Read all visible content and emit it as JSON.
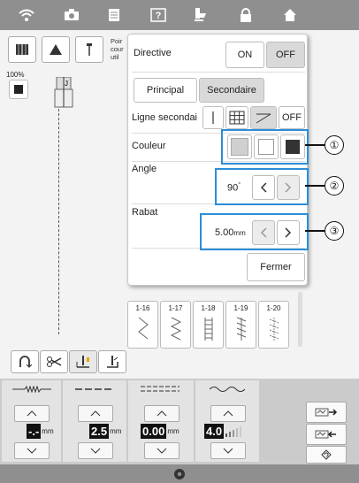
{
  "topbar": {
    "icons": [
      "wifi-icon",
      "camera-icon",
      "document-icon",
      "help-icon",
      "thread-icon",
      "lock-icon",
      "home-icon"
    ]
  },
  "left_panel": {
    "zoom": "100%",
    "truncated_text": [
      "Poir",
      "cour",
      "util"
    ]
  },
  "dialog": {
    "directive_label": "Directive",
    "directive_on": "ON",
    "directive_off": "OFF",
    "tab_principal": "Principal",
    "tab_secondaire": "Secondaire",
    "ligne_label": "Ligne secondai",
    "ligne_off": "OFF",
    "couleur_label": "Couleur",
    "angle_label": "Angle",
    "angle_value": "90",
    "angle_unit": "°",
    "rabat_label": "Rabat",
    "rabat_value": "5.00",
    "rabat_unit": "mm",
    "close": "Fermer"
  },
  "callouts": [
    "①",
    "②",
    "③"
  ],
  "stitches": [
    "1-16",
    "1-17",
    "1-18",
    "1-19",
    "1-20"
  ],
  "bottom": {
    "width_value": "-.-",
    "width_unit": "mm",
    "length_value": "2.5",
    "length_unit": "mm",
    "tension_value": "0.00",
    "tension_unit": "mm",
    "pressure_value": "4.0"
  },
  "colors": {
    "highlight": "#2b8ed8",
    "topbar": "#8f8f8f",
    "color_option_selected": "#d0d0d0",
    "color_option_black": "#333333"
  }
}
